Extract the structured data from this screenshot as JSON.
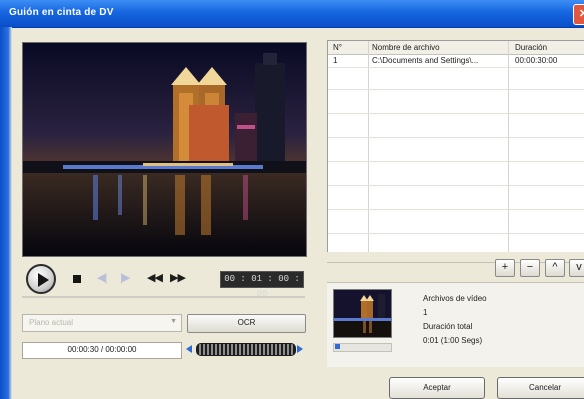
{
  "window": {
    "title": "Guión en cinta de DV",
    "close_glyph": "✕"
  },
  "file_list": {
    "columns": {
      "number": "N°",
      "name": "Nombre de archivo",
      "duration": "Duración"
    },
    "rows": [
      {
        "number": "1",
        "name": "C:\\Documents and Settings\\...",
        "duration": "00:00:30:00"
      }
    ]
  },
  "list_buttons": {
    "add": "+",
    "remove": "−",
    "up": "^",
    "down": "v"
  },
  "transport": {
    "timecode": "00 : 01 : 00 : 00",
    "prev_frame_glyph": "◀|",
    "next_frame_glyph": "|▶",
    "rewind_glyph": "◀◀",
    "forward_glyph": "▶▶"
  },
  "controls": {
    "dropdown_value": "Plano actual",
    "ocr_button": "OCR",
    "range_value": "00:00:30 / 00:00:00"
  },
  "info": {
    "line1": "Archivos de vídeo",
    "line2": "1",
    "line3": "Duración total",
    "line4": "0:01 (1:00 Segs)"
  },
  "dialog": {
    "ok": "Aceptar",
    "cancel": "Cancelar"
  },
  "icons": {
    "play": "play-icon",
    "stop": "stop-icon",
    "rewind": "rewind-icon",
    "forward": "fast-forward-icon",
    "jog": "jog-shuttle-icon",
    "close": "close-icon"
  },
  "colors": {
    "titlebar": "#1666e0",
    "timecode_bg": "#2a2a2a",
    "accent": "#2f6bd6"
  }
}
